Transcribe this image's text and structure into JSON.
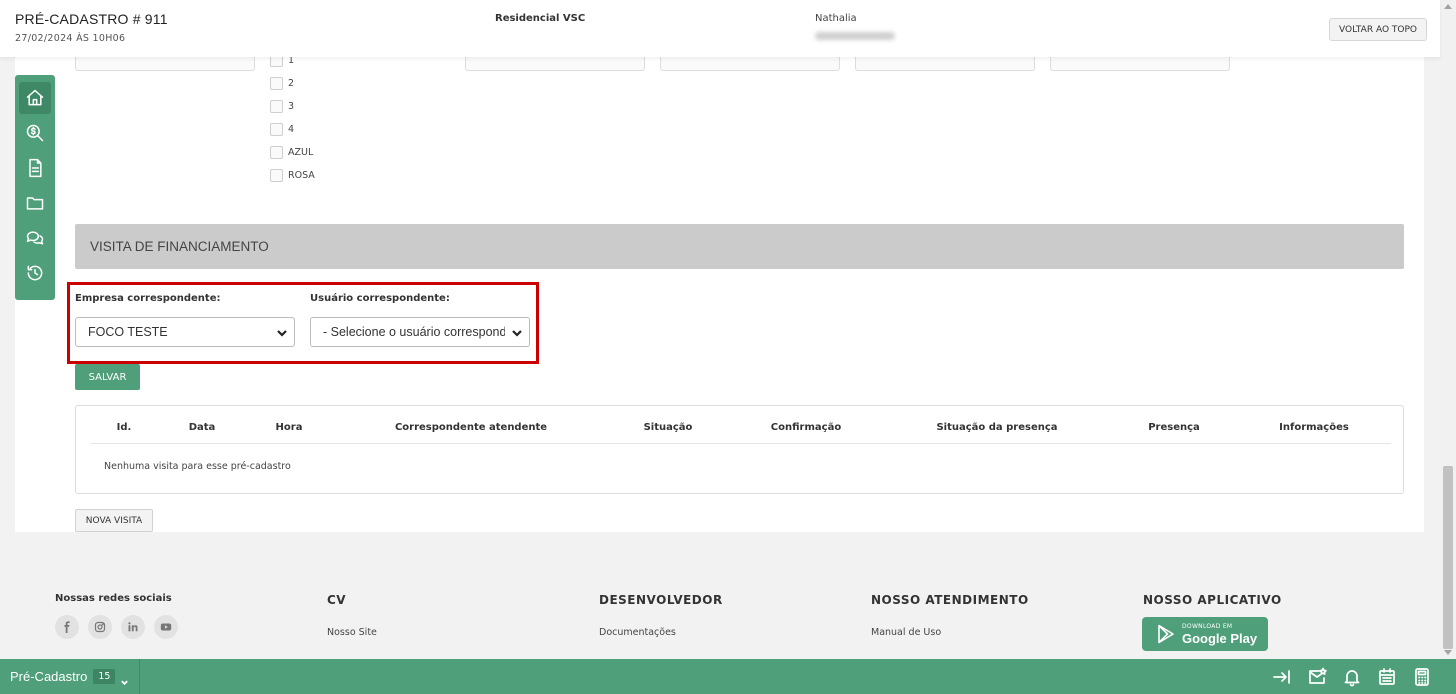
{
  "header": {
    "title": "PRÉ-CADASTRO # 911",
    "date": "27/02/2024 ÀS 10H06",
    "project": "Residencial VSC",
    "user": "Nathalia",
    "back_to_top_label": "VOLTAR AO TOPO"
  },
  "checkboxes": [
    "1",
    "2",
    "3",
    "4",
    "AZUL",
    "ROSA"
  ],
  "section": {
    "title": "VISITA DE FINANCIAMENTO"
  },
  "form": {
    "company_label": "Empresa correspondente:",
    "company_value": "FOCO TESTE",
    "user_label": "Usuário correspondente:",
    "user_value": "- Selecione o usuário correspondente -",
    "save_label": "SALVAR"
  },
  "table": {
    "columns": [
      "Id.",
      "Data",
      "Hora",
      "Correspondente atendente",
      "Situação",
      "Confirmação",
      "Situação da presença",
      "Presença",
      "Informações"
    ],
    "empty_message": "Nenhuma visita para esse pré-cadastro"
  },
  "new_visit_label": "NOVA VISITA",
  "footer": {
    "social_title": "Nossas redes sociais",
    "social_icons": [
      "facebook-icon",
      "instagram-icon",
      "linkedin-icon",
      "youtube-icon"
    ],
    "columns": [
      {
        "title": "CV",
        "link": "Nosso Site"
      },
      {
        "title": "DESENVOLVEDOR",
        "link": "Documentações"
      },
      {
        "title": "NOSSO ATENDIMENTO",
        "link": "Manual de Uso"
      },
      {
        "title": "NOSSO APLICATIVO",
        "link": ""
      }
    ],
    "app_badge": {
      "small": "DOWNLOAD EM",
      "big": "Google Play"
    }
  },
  "bottombar": {
    "tab_label": "Pré-Cadastro",
    "tab_count": "15"
  },
  "colors": {
    "brand_green": "#4e9f7a",
    "highlight_red": "#cc0000",
    "section_gray": "#cbcbcb"
  }
}
